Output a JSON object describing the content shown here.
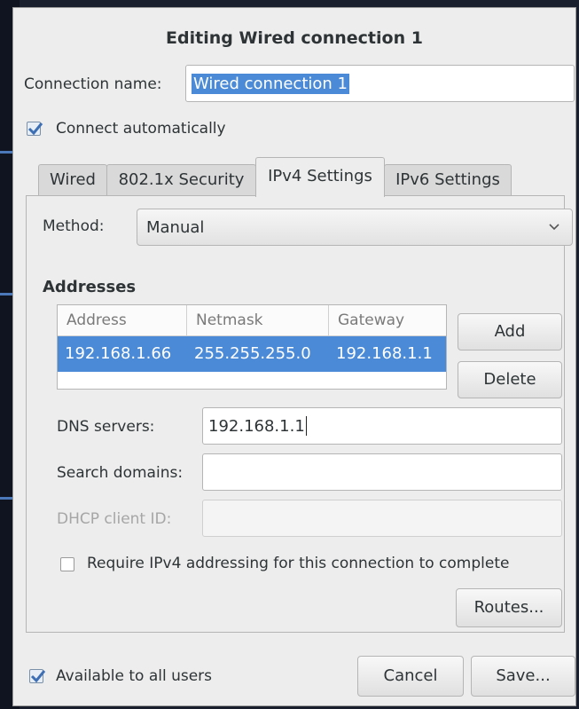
{
  "dialog": {
    "title": "Editing Wired connection 1",
    "connection_name_label": "Connection name:",
    "connection_name_value": "Wired connection 1",
    "connect_automatically_label": "Connect automatically",
    "connect_automatically_checked": true
  },
  "tabs": [
    {
      "label": "Wired",
      "active": false
    },
    {
      "label": "802.1x Security",
      "active": false
    },
    {
      "label": "IPv4 Settings",
      "active": true
    },
    {
      "label": "IPv6 Settings",
      "active": false
    }
  ],
  "ipv4": {
    "method_label": "Method:",
    "method_value": "Manual",
    "addresses_heading": "Addresses",
    "columns": [
      "Address",
      "Netmask",
      "Gateway"
    ],
    "rows": [
      [
        "192.168.1.66",
        "255.255.255.0",
        "192.168.1.1"
      ]
    ],
    "add_button": "Add",
    "delete_button": "Delete",
    "dns_label": "DNS servers:",
    "dns_value": "192.168.1.1",
    "search_domains_label": "Search domains:",
    "search_domains_value": "",
    "dhcp_client_id_label": "DHCP client ID:",
    "dhcp_client_id_value": "",
    "require_ipv4_label": "Require IPv4 addressing for this connection to complete",
    "require_ipv4_checked": false,
    "routes_button": "Routes..."
  },
  "footer": {
    "available_to_all_users_label": "Available to all users",
    "available_to_all_users_checked": true,
    "cancel_button": "Cancel",
    "save_button": "Save..."
  },
  "colors": {
    "selection": "#4a8ad6",
    "window_bg": "#ededed",
    "desktop_bg": "#1a1f2e"
  }
}
